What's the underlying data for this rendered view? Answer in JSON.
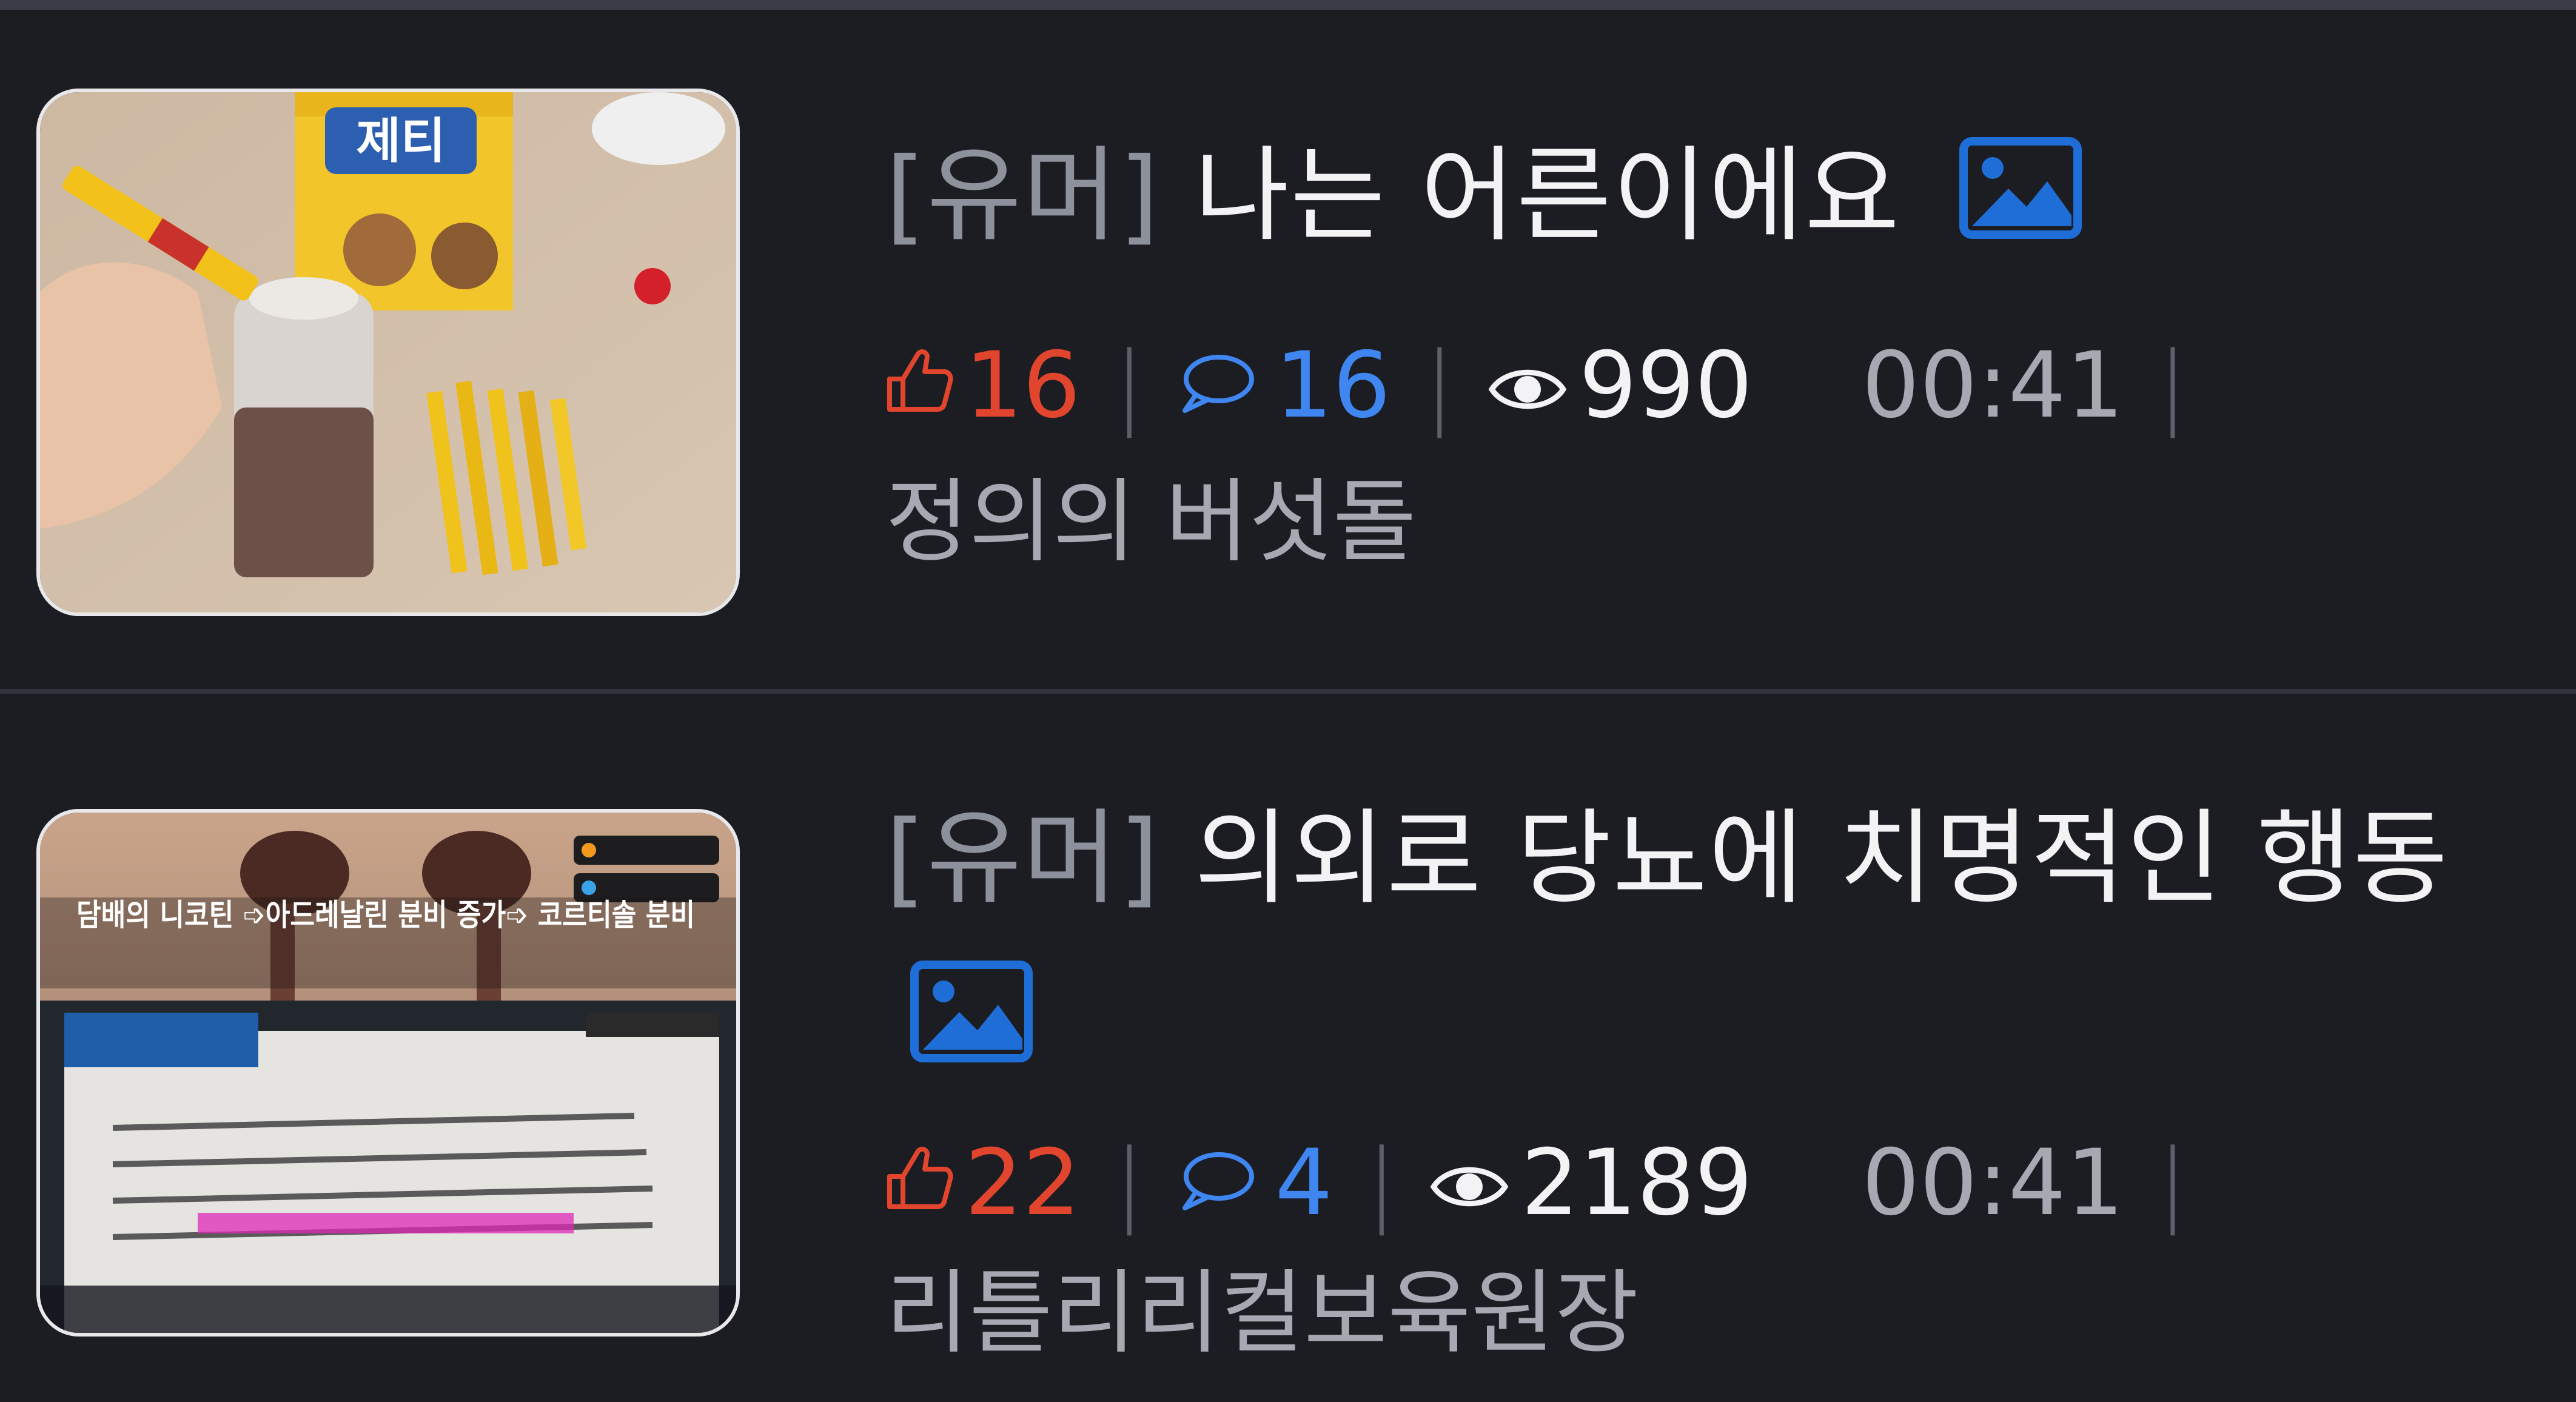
{
  "posts": [
    {
      "category": "[유머]",
      "title": "나는 어른이에요",
      "likes": "16",
      "comments": "16",
      "views": "990",
      "time": "00:41",
      "author": "정의의 버섯돌",
      "thumbnail_text": "제티"
    },
    {
      "category": "[유머]",
      "title": "의외로 당뇨에 치명적인 행동",
      "likes": "22",
      "comments": "4",
      "views": "2189",
      "time": "00:41",
      "author": "리틀리리컬보육원장",
      "thumbnail_text": "담배의 니코틴 ➩아드레날린 분비 증가➩ 코르티솔 분비"
    }
  ],
  "separator": "|",
  "colors": {
    "background": "#1b1d23",
    "like": "#e2452d",
    "comment": "#3f86f0",
    "category": "#8d919b",
    "image_badge": "#1f6ed8"
  },
  "icons": {
    "like": "thumbs-up-icon",
    "comment": "comment-icon",
    "views": "eye-icon",
    "image": "image-icon"
  }
}
